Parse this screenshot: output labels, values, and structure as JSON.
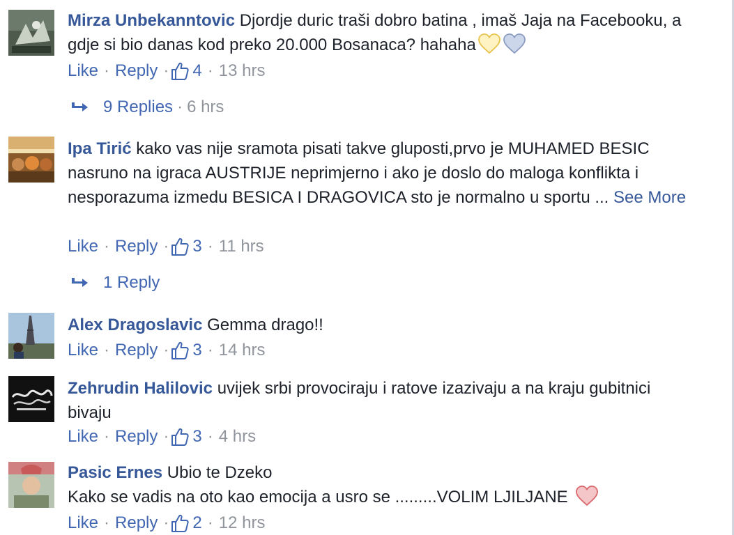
{
  "comments": [
    {
      "author": "Mirza Unbekanntovic",
      "text": "Djordje duric traši dobro batina , imaš Jaja na Facebooku, a gdje si bio danas kod preko 20.000 Bosanaca? hahaha",
      "like": "Like",
      "reply": "Reply",
      "likes": "4",
      "time": "13 hrs",
      "replies": "9 Replies",
      "replies_time": "6 hrs"
    },
    {
      "author": "Ipa Tirić",
      "text": "kako vas nije sramota pisati takve gluposti,prvo je MUHAMED BESIC nasruno na igraca AUSTRIJE neprimjerno i ako je doslo do maloga konflikta i nesporazuma izmedu BESICA I DRAGOVICA sto je normalno u sportu ...",
      "see_more": "See More",
      "like": "Like",
      "reply": "Reply",
      "likes": "3",
      "time": "11 hrs",
      "replies": "1 Reply"
    },
    {
      "author": "Alex Dragoslavic",
      "text": "Gemma drago!!",
      "like": "Like",
      "reply": "Reply",
      "likes": "3",
      "time": "14 hrs"
    },
    {
      "author": "Zehrudin Halilovic",
      "text": "uvijek srbi provociraju i ratove izazivaju a na kraju gubitnici bivaju",
      "like": "Like",
      "reply": "Reply",
      "likes": "3",
      "time": "4 hrs"
    },
    {
      "author": "Pasic Ernes",
      "text": "Ubio te Dzeko",
      "text2": "Kako se vadis na oto kao emocija a usro se .........VOLIM LJILJANE",
      "like": "Like",
      "reply": "Reply",
      "likes": "2",
      "time": "12 hrs"
    }
  ],
  "colors": {
    "author": "#365899",
    "link": "#4267b2",
    "meta": "#90949c",
    "text": "#1d2129"
  }
}
